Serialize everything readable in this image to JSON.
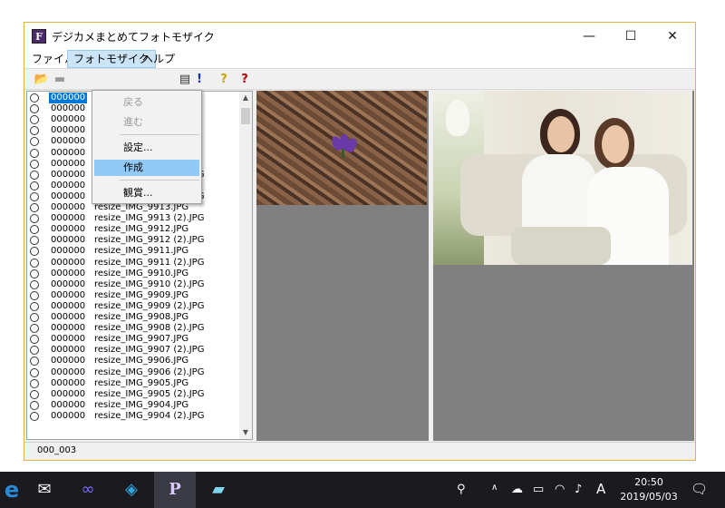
{
  "window": {
    "title": "デジカメまとめてフォトモザイク",
    "icon_letter": "F",
    "controls": {
      "minimize": "—",
      "maximize": "☐",
      "close": "✕"
    }
  },
  "menu": [
    {
      "label": "ファイル"
    },
    {
      "label": "フォトモザイク"
    },
    {
      "label": "ヘルプ"
    }
  ],
  "toolbar": {
    "exclaim": "!",
    "help1": "?",
    "help2": "?"
  },
  "dropdown": {
    "items": [
      {
        "label": "戻る",
        "state": "disabled"
      },
      {
        "label": "進む",
        "state": "disabled"
      },
      {
        "label": "設定...",
        "state": "normal"
      },
      {
        "label": "作成",
        "state": "hover"
      },
      {
        "label": "観賞...",
        "state": "normal"
      }
    ]
  },
  "filelist": {
    "rows": [
      {
        "num": "000000",
        "name": ".JPG",
        "selected": true
      },
      {
        "num": "000000",
        "name": ".JPG"
      },
      {
        "num": "000000",
        "name": ".JPG"
      },
      {
        "num": "000000",
        "name": ".JPG"
      },
      {
        "num": "000000",
        "name": ".JPG"
      },
      {
        "num": "000000",
        "name": ".JPG"
      },
      {
        "num": "000000",
        "name": ".JPG"
      },
      {
        "num": "000000",
        "name": "resize_IMG_9915 (2).JPG"
      },
      {
        "num": "000000",
        "name": "resize_IMG_9914.JPG"
      },
      {
        "num": "000000",
        "name": "resize_IMG_9914 (2).JPG"
      },
      {
        "num": "000000",
        "name": "resize_IMG_9913.JPG"
      },
      {
        "num": "000000",
        "name": "resize_IMG_9913 (2).JPG"
      },
      {
        "num": "000000",
        "name": "resize_IMG_9912.JPG"
      },
      {
        "num": "000000",
        "name": "resize_IMG_9912 (2).JPG"
      },
      {
        "num": "000000",
        "name": "resize_IMG_9911.JPG"
      },
      {
        "num": "000000",
        "name": "resize_IMG_9911 (2).JPG"
      },
      {
        "num": "000000",
        "name": "resize_IMG_9910.JPG"
      },
      {
        "num": "000000",
        "name": "resize_IMG_9910 (2).JPG"
      },
      {
        "num": "000000",
        "name": "resize_IMG_9909.JPG"
      },
      {
        "num": "000000",
        "name": "resize_IMG_9909 (2).JPG"
      },
      {
        "num": "000000",
        "name": "resize_IMG_9908.JPG"
      },
      {
        "num": "000000",
        "name": "resize_IMG_9908 (2).JPG"
      },
      {
        "num": "000000",
        "name": "resize_IMG_9907.JPG"
      },
      {
        "num": "000000",
        "name": "resize_IMG_9907 (2).JPG"
      },
      {
        "num": "000000",
        "name": "resize_IMG_9906.JPG"
      },
      {
        "num": "000000",
        "name": "resize_IMG_9906 (2).JPG"
      },
      {
        "num": "000000",
        "name": "resize_IMG_9905.JPG"
      },
      {
        "num": "000000",
        "name": "resize_IMG_9905 (2).JPG"
      },
      {
        "num": "000000",
        "name": "resize_IMG_9904.JPG"
      },
      {
        "num": "000000",
        "name": "resize_IMG_9904 (2).JPG"
      }
    ]
  },
  "status": {
    "text": "000_003"
  },
  "taskbar": {
    "tray_lang": "A",
    "time": "20:50",
    "date": "2019/05/03"
  },
  "colors": {
    "accent": "#0078d7",
    "menu_hover": "#91c9f7",
    "window_border": "#e3b04b",
    "pane_bg": "#808080"
  }
}
